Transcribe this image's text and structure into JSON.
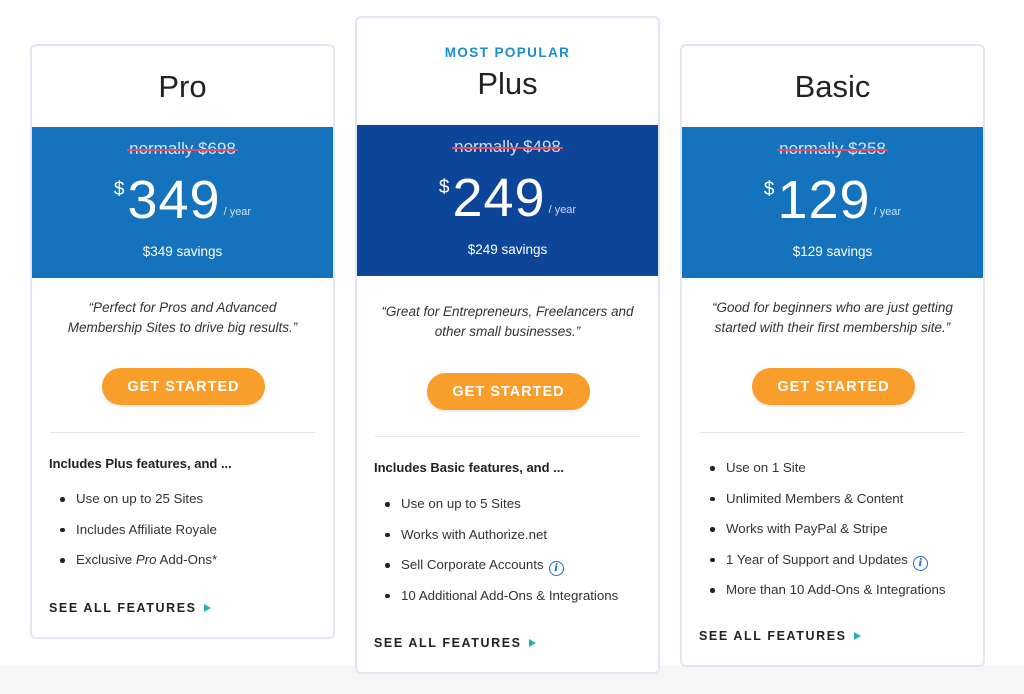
{
  "colors": {
    "accent_blue": "#1572bd",
    "popular_blue": "#0d4599",
    "cta_orange": "#f99d2b",
    "strike_red": "#e8495f",
    "arrow_teal": "#23b4b0"
  },
  "plans": [
    {
      "title": "Pro",
      "normally": "normally $698",
      "currency": "$",
      "amount": "349",
      "per": "/ year",
      "savings": "$349 savings",
      "quote_line1": "“Perfect for Pros and Advanced",
      "quote_line2": "Membership Sites to drive big results.”",
      "cta": "GET STARTED",
      "includes": "Includes Plus features, and ...",
      "features": [
        {
          "text": "Use on up to 25 Sites"
        },
        {
          "text": "Includes Affiliate Royale"
        },
        {
          "pre": "Exclusive ",
          "em": "Pro",
          "post": " Add-Ons*"
        }
      ],
      "see_all": "SEE ALL FEATURES"
    },
    {
      "badge": "MOST POPULAR",
      "title": "Plus",
      "normally": "normally $498",
      "currency": "$",
      "amount": "249",
      "per": "/ year",
      "savings": "$249 savings",
      "quote_line1": "“Great for Entrepreneurs, Freelancers and",
      "quote_line2": "other small businesses.”",
      "cta": "GET STARTED",
      "includes": "Includes Basic features, and ...",
      "features": [
        {
          "text": "Use on up to 5 Sites"
        },
        {
          "text": "Works with Authorize.net"
        },
        {
          "text": "Sell Corporate Accounts",
          "icon": "info-icon"
        },
        {
          "text": "10 Additional Add-Ons & Integrations"
        }
      ],
      "see_all": "SEE ALL FEATURES"
    },
    {
      "title": "Basic",
      "normally": "normally $258",
      "currency": "$",
      "amount": "129",
      "per": "/ year",
      "savings": "$129 savings",
      "quote_line1": "“Good for beginners who are just getting",
      "quote_line2": "started with their first membership site.”",
      "cta": "GET STARTED",
      "features": [
        {
          "text": "Use on 1 Site"
        },
        {
          "text": "Unlimited Members & Content"
        },
        {
          "text": "Works with PayPal & Stripe"
        },
        {
          "text": "1 Year of Support and Updates",
          "icon": "info-icon"
        },
        {
          "text": "More than 10 Add-Ons & Integrations"
        }
      ],
      "see_all": "SEE ALL FEATURES"
    }
  ]
}
